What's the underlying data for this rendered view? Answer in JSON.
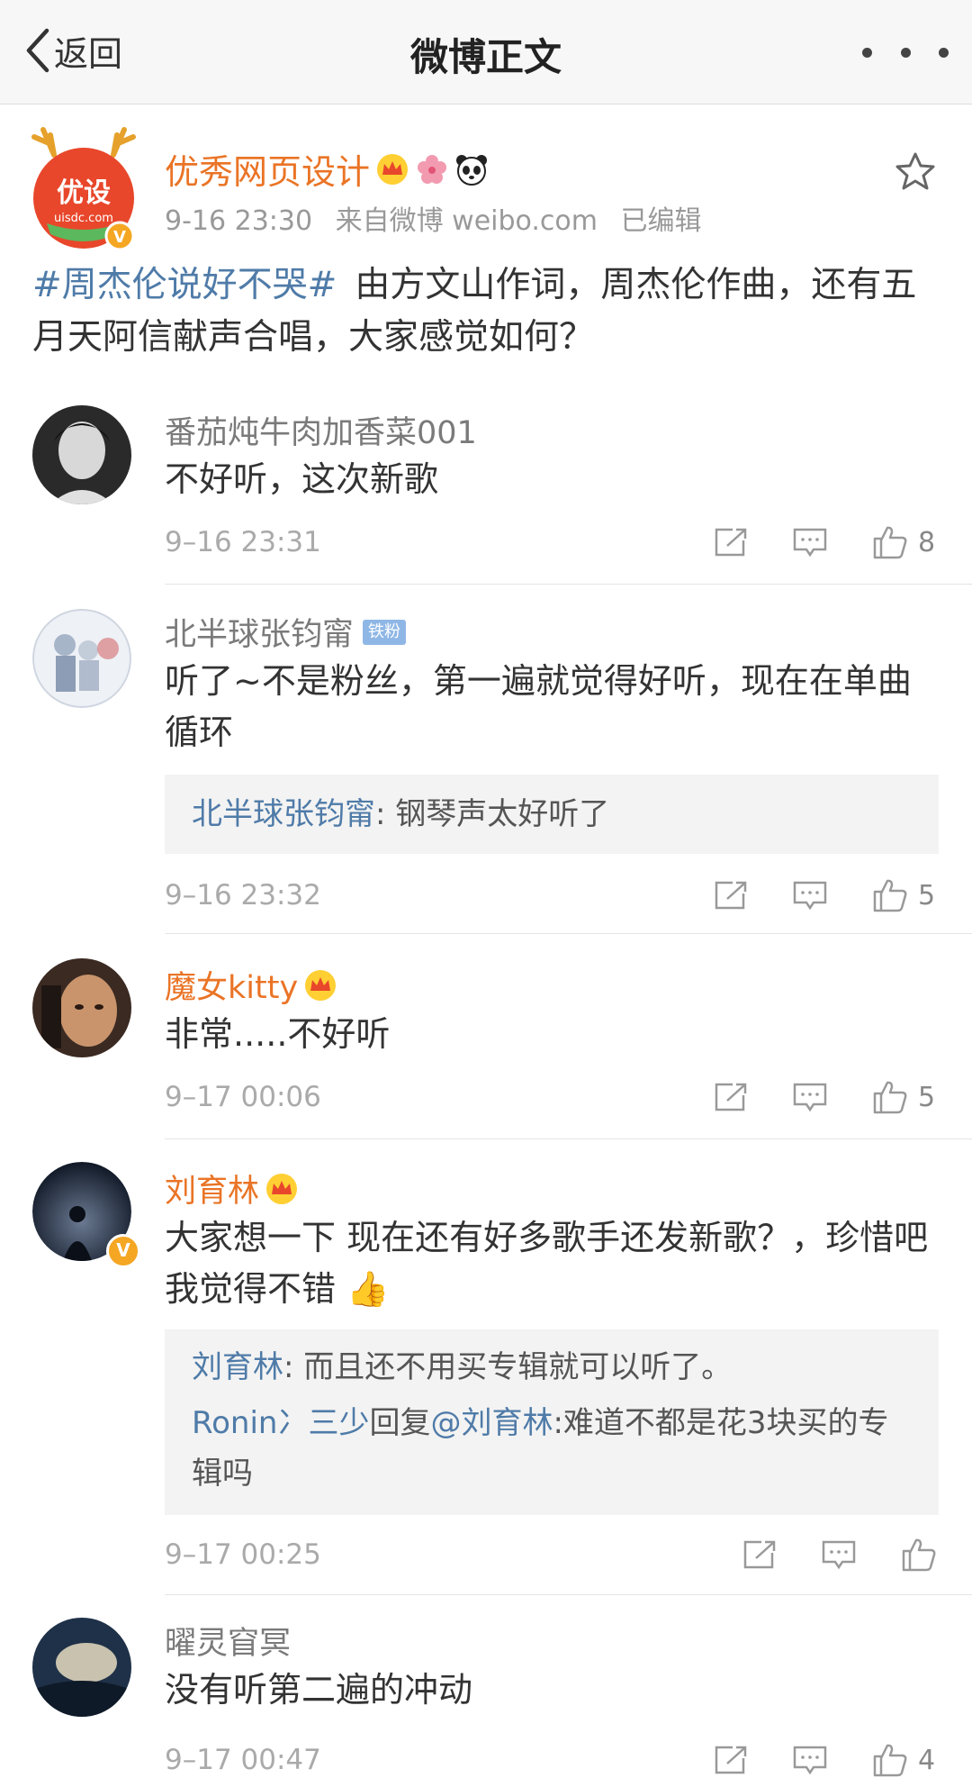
{
  "nav": {
    "back_label": "返回",
    "title": "微博正文"
  },
  "post": {
    "author": "优秀网页设计",
    "avatar_text": "优设",
    "avatar_sub": "uisdc.com",
    "time": "9-16 23:30",
    "source": "来自微博 weibo.com",
    "edited": "已编辑",
    "topic": "#周杰伦说好不哭#",
    "body": "由方文山作词，周杰伦作曲，还有五月天阿信献声合唱，大家感觉如何？"
  },
  "comments": [
    {
      "user": "番茄炖牛肉加香菜001",
      "text": "不好听，这次新歌",
      "time": "9–16 23:31",
      "likes": "8"
    },
    {
      "user": "北半球张钧甯",
      "badge": "铁粉",
      "text": "听了~不是粉丝，第一遍就觉得好听，现在在单曲循环",
      "replies": [
        {
          "user": "北半球张钧甯",
          "sep": ": ",
          "text": "钢琴声太好听了"
        }
      ],
      "time": "9–16 23:32",
      "likes": "5"
    },
    {
      "user": "魔女kitty",
      "text": "非常.....不好听",
      "time": "9–17 00:06",
      "likes": "5"
    },
    {
      "user": "刘育林",
      "text": "大家想一下 现在还有好多歌手还发新歌？，珍惜吧 我觉得不错 👍",
      "replies": [
        {
          "user": "刘育林",
          "sep": ": ",
          "text": "而且还不用买专辑就可以听了。"
        },
        {
          "user": "Ronin冫三少",
          "mid": "回复",
          "mention": "@刘育林",
          "sep": ":",
          "text": "难道不都是花3块买的专辑吗"
        }
      ],
      "time": "9–17 00:25",
      "likes": ""
    },
    {
      "user": "曜灵窅冥",
      "text": "没有听第二遍的冲动",
      "time": "9–17 00:47",
      "likes": "4"
    }
  ],
  "colors": {
    "accent_orange": "#ea7426",
    "link_blue": "#4f7ba8",
    "meta_gray": "#999999"
  },
  "icons": [
    "chevron-left-icon",
    "more-icon",
    "star-icon",
    "crown-icon",
    "flower-icon",
    "panda-icon",
    "share-icon",
    "comment-icon",
    "like-icon"
  ]
}
